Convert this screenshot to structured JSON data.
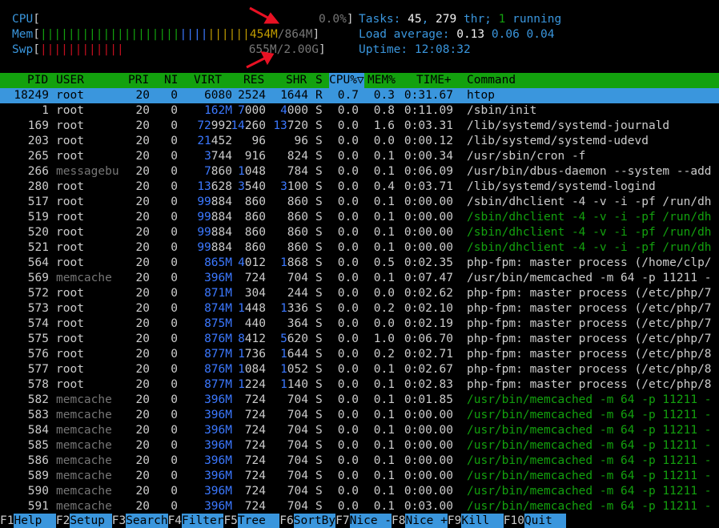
{
  "meters": {
    "cpu": {
      "label": "CPU",
      "bar": "",
      "value": "0.0%"
    },
    "mem": {
      "label": "Mem",
      "bar_green": "||||||||||||||||||||",
      "bar_blue": "||||",
      "bar_yellow": "||||||",
      "used": "454M",
      "total": "864M"
    },
    "swp": {
      "label": "Swp",
      "bar_red": "||||||||||||",
      "value": "655M/2.00G"
    }
  },
  "stats": {
    "tasks_label": "Tasks: ",
    "tasks": "45",
    "thr": "279",
    "thr_label": " thr; ",
    "running": "1",
    "running_label": " running",
    "load_label": "Load average: ",
    "load1": "0.13",
    "load5": "0.06",
    "load15": "0.04",
    "uptime_label": "Uptime: ",
    "uptime": "12:08:32"
  },
  "columns": {
    "pid": "PID",
    "user": "USER",
    "pri": "PRI",
    "ni": "NI",
    "virt": "VIRT",
    "res": "RES",
    "shr": "SHR",
    "s": "S",
    "cpu": "CPU%▽",
    "mem": "MEM%",
    "time": "TIME+",
    "command": "Command"
  },
  "colors": {
    "green": "#13a10e",
    "cyan": "#3a96dd",
    "blue": "#3b78ff",
    "yellow": "#c19c00",
    "red": "#c50f1f",
    "gray": "#767676"
  },
  "processes": [
    {
      "pid": "18249",
      "user": "root",
      "pri": "20",
      "ni": "0",
      "virt": "6080",
      "res": "2524",
      "shr": "1644",
      "s": "R",
      "cpu": "0.7",
      "mem": "0.3",
      "time": "0:31.67",
      "cmd": "htop",
      "selected": true
    },
    {
      "pid": "1",
      "user": "root",
      "pri": "20",
      "ni": "0",
      "virt": "162M",
      "res": "7000",
      "shr": "4000",
      "s": "S",
      "cpu": "0.0",
      "mem": "0.8",
      "time": "0:11.09",
      "cmd": "/sbin/init"
    },
    {
      "pid": "169",
      "user": "root",
      "pri": "20",
      "ni": "0",
      "virt": "72992",
      "res": "14260",
      "shr": "13720",
      "s": "S",
      "cpu": "0.0",
      "mem": "1.6",
      "time": "0:03.31",
      "cmd": "/lib/systemd/systemd-journald"
    },
    {
      "pid": "203",
      "user": "root",
      "pri": "20",
      "ni": "0",
      "virt": "21452",
      "res": "96",
      "shr": "96",
      "s": "S",
      "cpu": "0.0",
      "mem": "0.0",
      "time": "0:00.12",
      "cmd": "/lib/systemd/systemd-udevd"
    },
    {
      "pid": "265",
      "user": "root",
      "pri": "20",
      "ni": "0",
      "virt": "3744",
      "res": "916",
      "shr": "824",
      "s": "S",
      "cpu": "0.0",
      "mem": "0.1",
      "time": "0:00.34",
      "cmd": "/usr/sbin/cron -f"
    },
    {
      "pid": "266",
      "user": "messagebu",
      "pri": "20",
      "ni": "0",
      "virt": "7860",
      "res": "1048",
      "shr": "784",
      "s": "S",
      "cpu": "0.0",
      "mem": "0.1",
      "time": "0:06.09",
      "cmd": "/usr/bin/dbus-daemon --system --add",
      "dimuser": true
    },
    {
      "pid": "280",
      "user": "root",
      "pri": "20",
      "ni": "0",
      "virt": "13628",
      "res": "3540",
      "shr": "3100",
      "s": "S",
      "cpu": "0.0",
      "mem": "0.4",
      "time": "0:03.71",
      "cmd": "/lib/systemd/systemd-logind"
    },
    {
      "pid": "517",
      "user": "root",
      "pri": "20",
      "ni": "0",
      "virt": "99884",
      "res": "860",
      "shr": "860",
      "s": "S",
      "cpu": "0.0",
      "mem": "0.1",
      "time": "0:00.00",
      "cmd": "/sbin/dhclient -4 -v -i -pf /run/dh"
    },
    {
      "pid": "519",
      "user": "root",
      "pri": "20",
      "ni": "0",
      "virt": "99884",
      "res": "860",
      "shr": "860",
      "s": "S",
      "cpu": "0.0",
      "mem": "0.1",
      "time": "0:00.00",
      "cmd": "/sbin/dhclient -4 -v -i -pf /run/dh",
      "thread": true
    },
    {
      "pid": "520",
      "user": "root",
      "pri": "20",
      "ni": "0",
      "virt": "99884",
      "res": "860",
      "shr": "860",
      "s": "S",
      "cpu": "0.0",
      "mem": "0.1",
      "time": "0:00.00",
      "cmd": "/sbin/dhclient -4 -v -i -pf /run/dh",
      "thread": true
    },
    {
      "pid": "521",
      "user": "root",
      "pri": "20",
      "ni": "0",
      "virt": "99884",
      "res": "860",
      "shr": "860",
      "s": "S",
      "cpu": "0.0",
      "mem": "0.1",
      "time": "0:00.00",
      "cmd": "/sbin/dhclient -4 -v -i -pf /run/dh",
      "thread": true
    },
    {
      "pid": "564",
      "user": "root",
      "pri": "20",
      "ni": "0",
      "virt": "865M",
      "res": "4012",
      "shr": "1868",
      "s": "S",
      "cpu": "0.0",
      "mem": "0.5",
      "time": "0:02.35",
      "cmd": "php-fpm: master process (/home/clp/"
    },
    {
      "pid": "569",
      "user": "memcache",
      "pri": "20",
      "ni": "0",
      "virt": "396M",
      "res": "724",
      "shr": "704",
      "s": "S",
      "cpu": "0.0",
      "mem": "0.1",
      "time": "0:07.47",
      "cmd": "/usr/bin/memcached -m 64 -p 11211 -",
      "dimuser": true
    },
    {
      "pid": "572",
      "user": "root",
      "pri": "20",
      "ni": "0",
      "virt": "871M",
      "res": "304",
      "shr": "244",
      "s": "S",
      "cpu": "0.0",
      "mem": "0.0",
      "time": "0:02.62",
      "cmd": "php-fpm: master process (/etc/php/7"
    },
    {
      "pid": "573",
      "user": "root",
      "pri": "20",
      "ni": "0",
      "virt": "874M",
      "res": "1448",
      "shr": "1336",
      "s": "S",
      "cpu": "0.0",
      "mem": "0.2",
      "time": "0:02.10",
      "cmd": "php-fpm: master process (/etc/php/7"
    },
    {
      "pid": "574",
      "user": "root",
      "pri": "20",
      "ni": "0",
      "virt": "875M",
      "res": "440",
      "shr": "364",
      "s": "S",
      "cpu": "0.0",
      "mem": "0.0",
      "time": "0:02.19",
      "cmd": "php-fpm: master process (/etc/php/7"
    },
    {
      "pid": "575",
      "user": "root",
      "pri": "20",
      "ni": "0",
      "virt": "876M",
      "res": "8412",
      "shr": "5620",
      "s": "S",
      "cpu": "0.0",
      "mem": "1.0",
      "time": "0:06.70",
      "cmd": "php-fpm: master process (/etc/php/7"
    },
    {
      "pid": "576",
      "user": "root",
      "pri": "20",
      "ni": "0",
      "virt": "877M",
      "res": "1736",
      "shr": "1644",
      "s": "S",
      "cpu": "0.0",
      "mem": "0.2",
      "time": "0:02.71",
      "cmd": "php-fpm: master process (/etc/php/8"
    },
    {
      "pid": "577",
      "user": "root",
      "pri": "20",
      "ni": "0",
      "virt": "876M",
      "res": "1084",
      "shr": "1052",
      "s": "S",
      "cpu": "0.0",
      "mem": "0.1",
      "time": "0:02.67",
      "cmd": "php-fpm: master process (/etc/php/8"
    },
    {
      "pid": "578",
      "user": "root",
      "pri": "20",
      "ni": "0",
      "virt": "877M",
      "res": "1224",
      "shr": "1140",
      "s": "S",
      "cpu": "0.0",
      "mem": "0.1",
      "time": "0:02.83",
      "cmd": "php-fpm: master process (/etc/php/8"
    },
    {
      "pid": "582",
      "user": "memcache",
      "pri": "20",
      "ni": "0",
      "virt": "396M",
      "res": "724",
      "shr": "704",
      "s": "S",
      "cpu": "0.0",
      "mem": "0.1",
      "time": "0:01.85",
      "cmd": "/usr/bin/memcached -m 64 -p 11211 -",
      "dimuser": true,
      "thread": true
    },
    {
      "pid": "583",
      "user": "memcache",
      "pri": "20",
      "ni": "0",
      "virt": "396M",
      "res": "724",
      "shr": "704",
      "s": "S",
      "cpu": "0.0",
      "mem": "0.1",
      "time": "0:00.00",
      "cmd": "/usr/bin/memcached -m 64 -p 11211 -",
      "dimuser": true,
      "thread": true
    },
    {
      "pid": "584",
      "user": "memcache",
      "pri": "20",
      "ni": "0",
      "virt": "396M",
      "res": "724",
      "shr": "704",
      "s": "S",
      "cpu": "0.0",
      "mem": "0.1",
      "time": "0:00.00",
      "cmd": "/usr/bin/memcached -m 64 -p 11211 -",
      "dimuser": true,
      "thread": true
    },
    {
      "pid": "585",
      "user": "memcache",
      "pri": "20",
      "ni": "0",
      "virt": "396M",
      "res": "724",
      "shr": "704",
      "s": "S",
      "cpu": "0.0",
      "mem": "0.1",
      "time": "0:00.00",
      "cmd": "/usr/bin/memcached -m 64 -p 11211 -",
      "dimuser": true,
      "thread": true
    },
    {
      "pid": "586",
      "user": "memcache",
      "pri": "20",
      "ni": "0",
      "virt": "396M",
      "res": "724",
      "shr": "704",
      "s": "S",
      "cpu": "0.0",
      "mem": "0.1",
      "time": "0:00.00",
      "cmd": "/usr/bin/memcached -m 64 -p 11211 -",
      "dimuser": true,
      "thread": true
    },
    {
      "pid": "589",
      "user": "memcache",
      "pri": "20",
      "ni": "0",
      "virt": "396M",
      "res": "724",
      "shr": "704",
      "s": "S",
      "cpu": "0.0",
      "mem": "0.1",
      "time": "0:00.00",
      "cmd": "/usr/bin/memcached -m 64 -p 11211 -",
      "dimuser": true,
      "thread": true
    },
    {
      "pid": "590",
      "user": "memcache",
      "pri": "20",
      "ni": "0",
      "virt": "396M",
      "res": "724",
      "shr": "704",
      "s": "S",
      "cpu": "0.0",
      "mem": "0.1",
      "time": "0:00.00",
      "cmd": "/usr/bin/memcached -m 64 -p 11211 -",
      "dimuser": true,
      "thread": true
    },
    {
      "pid": "591",
      "user": "memcache",
      "pri": "20",
      "ni": "0",
      "virt": "396M",
      "res": "724",
      "shr": "704",
      "s": "S",
      "cpu": "0.0",
      "mem": "0.1",
      "time": "0:03.00",
      "cmd": "/usr/bin/memcached -m 64 -p 11211 -",
      "dimuser": true,
      "thread": true
    }
  ],
  "function_keys": [
    {
      "key": "F1",
      "label": "Help  "
    },
    {
      "key": "F2",
      "label": "Setup "
    },
    {
      "key": "F3",
      "label": "Search"
    },
    {
      "key": "F4",
      "label": "Filter"
    },
    {
      "key": "F5",
      "label": "Tree  "
    },
    {
      "key": "F6",
      "label": "SortBy"
    },
    {
      "key": "F7",
      "label": "Nice -"
    },
    {
      "key": "F8",
      "label": "Nice +"
    },
    {
      "key": "F9",
      "label": "Kill  "
    },
    {
      "key": "F10",
      "label": "Quit  "
    }
  ]
}
